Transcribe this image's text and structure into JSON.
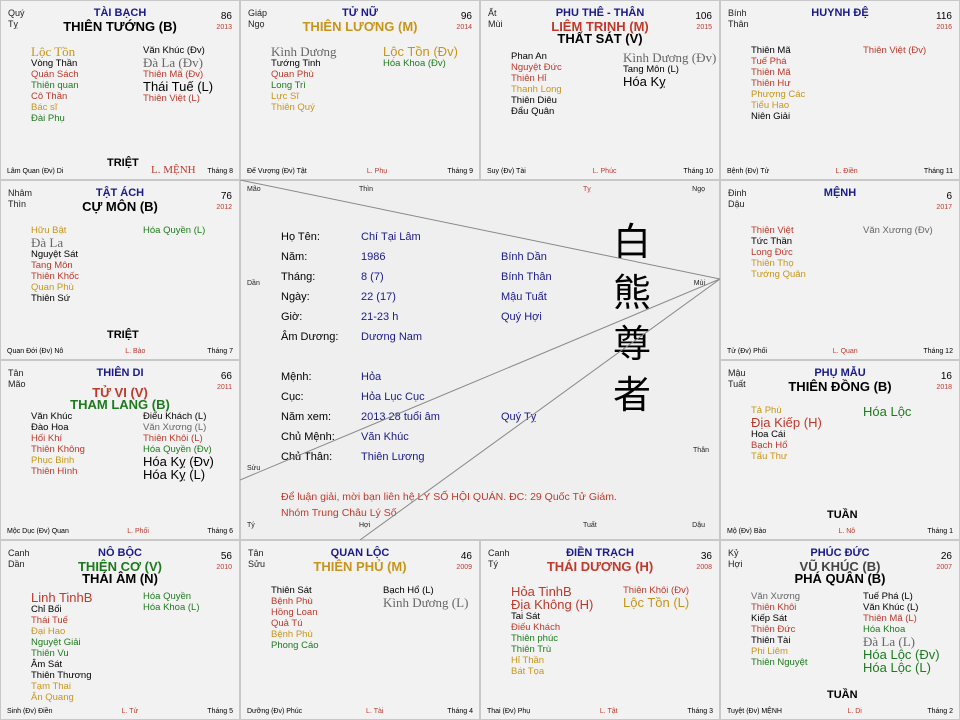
{
  "cells": {
    "taibach": {
      "can": [
        "Quý",
        "Tỵ"
      ],
      "palace": "TÀI BẠCH",
      "age": "86",
      "year": "2013",
      "main": [
        "THIÊN TƯỚNG (B)"
      ],
      "left": [
        [
          "Lộc Tồn",
          "cgold big serif"
        ],
        [
          "Vòng Thần",
          "cblk"
        ],
        [
          "Quán Sách",
          "cr"
        ],
        [
          "Thiên quan",
          "cg"
        ],
        [
          "Cô Thần",
          "cr"
        ],
        [
          "Bác sĩ",
          "cgold"
        ],
        [
          "Đài Phụ",
          "cg"
        ]
      ],
      "right": [
        [
          "Văn Khúc (Đv)",
          "cblk"
        ],
        [
          "Đà La (Đv)",
          "cgray big serif"
        ],
        [
          "Thiên Mã (Đv)",
          "cr"
        ],
        [
          "Thái Tuế (L)",
          "cblk big"
        ],
        [
          "Thiên Việt (L)",
          "cr"
        ]
      ],
      "mark": "TRIỆT",
      "mark2": "L. MỆNH",
      "foot": [
        "Lâm Quan (Đv) Di",
        "",
        "Tháng 8"
      ]
    },
    "tunu": {
      "can": [
        "Giáp",
        "Ngọ"
      ],
      "palace": "TỬ NỮ",
      "age": "96",
      "year": "2014",
      "main": [
        "THIÊN LƯƠNG (M)"
      ],
      "left": [
        [
          "Kình Dương",
          "cgray big serif"
        ],
        [
          "Tướng Tinh",
          "cblk"
        ],
        [
          "Quan Phù",
          "cr"
        ],
        [
          "Long Trì",
          "cg"
        ],
        [
          "Lực Sĩ",
          "cgold"
        ],
        [
          "Thiên Quý",
          "cgold"
        ]
      ],
      "right": [
        [
          "Lộc Tồn (Đv)",
          "cgold big"
        ],
        [
          "Hóa Khoa (Đv)",
          "cg"
        ]
      ],
      "foot": [
        "Đế Vượng (Đv) Tật",
        "L. Phụ",
        "Tháng 9"
      ]
    },
    "phuthe": {
      "can": [
        "Ất",
        "Mùi"
      ],
      "palace": "PHU THÊ - THÂN",
      "age": "106",
      "year": "2015",
      "main": [
        "LIÊM TRINH (M)",
        "THẤT SÁT (V)"
      ],
      "left": [
        [
          "Phan An",
          "cblk"
        ],
        [
          "Nguyệt Đức",
          "cr"
        ],
        [
          "Thiên Hỉ",
          "cr"
        ],
        [
          "Thanh Long",
          "cgold"
        ],
        [
          "Thiên Diêu",
          "cblk"
        ],
        [
          "Đẩu Quân",
          "cblk"
        ]
      ],
      "right": [
        [
          "Kình Dương (Đv)",
          "cgray big serif"
        ],
        [
          "Tang Môn (L)",
          "cblk"
        ],
        [
          "Hóa Kỵ",
          "cblk big"
        ]
      ],
      "foot": [
        "Suy (Đv) Tài",
        "L. Phúc",
        "Tháng 10"
      ]
    },
    "huynhde": {
      "can": [
        "Bính",
        "Thân"
      ],
      "palace": "HUYNH ĐỆ",
      "age": "116",
      "year": "2016",
      "main": [],
      "left": [
        [
          "Thiên Mã",
          "cblk"
        ],
        [
          "Tuế Phá",
          "cr"
        ],
        [
          "Thiên Mã",
          "cr"
        ],
        [
          "Thiên Hư",
          "cr"
        ],
        [
          "Phượng Các",
          "cgold"
        ],
        [
          "Tiểu Hao",
          "cgold"
        ],
        [
          "Niên Giải",
          "cblk"
        ]
      ],
      "right": [
        [
          "Thiên Việt (Đv)",
          "cr"
        ]
      ],
      "foot": [
        "Bệnh (Đv) Tử",
        "L. Điền",
        "Tháng 11"
      ]
    },
    "tatach": {
      "can": [
        "Nhâm",
        "Thìn"
      ],
      "palace": "TẬT ÁCH",
      "age": "76",
      "year": "2012",
      "main": [
        "CỰ MÔN (B)"
      ],
      "left": [
        [
          "Hữu Bật",
          "cgold"
        ],
        [
          "Đà La",
          "cgray big serif"
        ],
        [
          "Nguyệt Sát",
          "cblk"
        ],
        [
          "Tang Môn",
          "cr"
        ],
        [
          "Thiên Khốc",
          "cr"
        ],
        [
          "Quan Phù",
          "cgold"
        ],
        [
          "Thiên Sứ",
          "cblk"
        ]
      ],
      "right": [
        [
          "Hóa Quyền (L)",
          "cg"
        ]
      ],
      "mark": "TRIỆT",
      "foot": [
        "Quan Đới (Đv) Nô",
        "L. Bào",
        "Tháng 7"
      ]
    },
    "menh": {
      "can": [
        "Đinh",
        "Dậu"
      ],
      "palace": "MỆNH",
      "age": "6",
      "year": "2017",
      "main": [],
      "left": [
        [
          "Thiên Việt",
          "cr"
        ],
        [
          "Tức Thần",
          "cblk"
        ],
        [
          "Long Đức",
          "cr"
        ],
        [
          "Thiên Thọ",
          "cgold"
        ],
        [
          "Tướng Quân",
          "cgold"
        ]
      ],
      "right": [
        [
          "Văn Xương (Đv)",
          "cgray"
        ]
      ],
      "foot": [
        "Tử (Đv) Phối",
        "L. Quan",
        "Tháng 12"
      ]
    },
    "thiendi": {
      "can": [
        "Tân",
        "Mão"
      ],
      "palace": "THIÊN DI",
      "age": "66",
      "year": "2011",
      "main": [
        "TỬ VI (V)",
        "THAM LANG (B)"
      ],
      "left": [
        [
          "Văn Khúc",
          "cblk"
        ],
        [
          "Đào Hoa",
          "cblk"
        ],
        [
          "Hối Khí",
          "cr"
        ],
        [
          "Thiên Không",
          "cr"
        ],
        [
          "Phục Binh",
          "cgold"
        ],
        [
          "Thiên Hình",
          "cr"
        ]
      ],
      "right": [
        [
          "Điếu Khách (L)",
          "cblk"
        ],
        [
          "Văn Xương (L)",
          "cgray"
        ],
        [
          "Thiên Khôi (L)",
          "cr"
        ],
        [
          "Hóa Quyền (Đv)",
          "cg"
        ],
        [
          "Hóa Kỵ (Đv)",
          "cblk big"
        ],
        [
          "Hóa Kỵ (L)",
          "cblk big"
        ]
      ],
      "foot": [
        "Mộc Dục (Đv) Quan",
        "L. Phối",
        "Tháng 6"
      ]
    },
    "phumau": {
      "can": [
        "Mậu",
        "Tuất"
      ],
      "palace": "PHỤ MẪU",
      "age": "16",
      "year": "2018",
      "main": [
        "THIÊN ĐỒNG (B)"
      ],
      "left": [
        [
          "Tả Phù",
          "cgold"
        ],
        [
          "Địa Kiếp (H)",
          "cr big"
        ],
        [
          "Hoa Cái",
          "cblk"
        ],
        [
          "Bạch Hổ",
          "cr"
        ],
        [
          "Tấu Thư",
          "cgold"
        ]
      ],
      "right": [
        [
          "Hóa Lộc",
          "cg big"
        ]
      ],
      "mark": "TUẦN",
      "foot": [
        "Mộ (Đv) Bào",
        "L. Nô",
        "Tháng 1"
      ]
    },
    "nobọc": {
      "can": [
        "Canh",
        "Dần"
      ],
      "palace": "NÔ BỘC",
      "age": "56",
      "year": "2010",
      "main": [
        "THIÊN CƠ (V)",
        "THÁI ÂM (N)"
      ],
      "left": [
        [
          "Linh TinhB",
          "cr big"
        ],
        [
          "Chỉ Bối",
          "cblk"
        ],
        [
          "Thái Tuế",
          "cr"
        ],
        [
          "Đại Hao",
          "cgold"
        ],
        [
          "Nguyệt Giải",
          "cg"
        ],
        [
          "Thiên Vu",
          "cg"
        ],
        [
          "Âm Sát",
          "cblk"
        ],
        [
          "Thiên Thương",
          "cblk"
        ],
        [
          "Tạm Thai",
          "cgold"
        ],
        [
          "Ân Quang",
          "cgold"
        ]
      ],
      "right": [
        [
          "Hóa Quyền",
          "cg"
        ],
        [
          "Hóa Khoa (L)",
          "cg"
        ]
      ],
      "foot": [
        "Sinh (Đv) Điền",
        "L. Tử",
        "Tháng 5"
      ]
    },
    "quanloc": {
      "can": [
        "Tân",
        "Sửu"
      ],
      "palace": "QUAN LỘC",
      "age": "46",
      "year": "2009",
      "main": [
        "THIÊN PHỦ (M)"
      ],
      "left": [
        [
          "Thiên Sát",
          "cblk"
        ],
        [
          "Bệnh Phù",
          "cr"
        ],
        [
          "Hồng Loan",
          "cr"
        ],
        [
          "Quả Tú",
          "cr"
        ],
        [
          "Bệnh Phù",
          "cgold"
        ],
        [
          "Phong Cáo",
          "cg"
        ]
      ],
      "right": [
        [
          "Bạch Hổ (L)",
          "cblk"
        ],
        [
          "Kình Dương (L)",
          "cgray big serif"
        ]
      ],
      "foot": [
        "Dưỡng (Đv) Phúc",
        "L. Tài",
        "Tháng 4"
      ]
    },
    "dientrach": {
      "can": [
        "Canh",
        "Tý"
      ],
      "palace": "ĐIỀN TRẠCH",
      "age": "36",
      "year": "2008",
      "main": [
        "THÁI DƯƠNG (H)"
      ],
      "left": [
        [
          "Hỏa TinhB",
          "cr big"
        ],
        [
          "Địa Không (H)",
          "cr big"
        ],
        [
          "Tai Sát",
          "cblk"
        ],
        [
          "Điếu Khách",
          "cr"
        ],
        [
          "Thiên phúc",
          "cg"
        ],
        [
          "Thiên Trù",
          "cg"
        ],
        [
          "Hỉ Thần",
          "cgold"
        ],
        [
          "Bát Tọa",
          "cgold"
        ]
      ],
      "right": [
        [
          "Thiên Khôi (Đv)",
          "cr"
        ],
        [
          "Lộc Tồn (L)",
          "cgold big"
        ]
      ],
      "foot": [
        "Thai (Đv) Phụ",
        "L. Tật",
        "Tháng 3"
      ]
    },
    "phucduc": {
      "can": [
        "Kỷ",
        "Hợi"
      ],
      "palace": "PHÚC ĐỨC",
      "age": "26",
      "year": "2007",
      "main": [
        "VŨ KHÚC (B)",
        "PHÁ QUÂN (B)"
      ],
      "left": [
        [
          "Văn Xương",
          "cgray"
        ],
        [
          "Thiên Khôi",
          "cr"
        ],
        [
          "Kiếp Sát",
          "cblk"
        ],
        [
          "Thiên Đức",
          "cr"
        ],
        [
          "Thiên Tài",
          "cblk"
        ],
        [
          "Phi Liêm",
          "cgold"
        ],
        [
          "Thiên Nguyệt",
          "cg"
        ]
      ],
      "right": [
        [
          "Tuế Phá (L)",
          "cblk"
        ],
        [
          "Văn Khúc (L)",
          "cblk"
        ],
        [
          "Thiên Mã (L)",
          "cr"
        ],
        [
          "Hóa Khoa",
          "cg"
        ],
        [
          "Đà La (L)",
          "cgray big serif"
        ],
        [
          "Hóa Lộc (Đv)",
          "cg big"
        ],
        [
          "Hóa Lộc (L)",
          "cg big"
        ]
      ],
      "mark": "TUẦN",
      "foot": [
        "Tuyệt (Đv) MỆNH",
        "L. Di",
        "Tháng 2"
      ]
    }
  },
  "center": {
    "branches": {
      "tl": "Mão",
      "tr": "Ngọ",
      "mt": "Thìn",
      "mtr": "Tỵ",
      "l1": "Dần",
      "r1": "Mùi",
      "r2": "Thân",
      "l2": "Sửu",
      "bl": "Tý",
      "bm": "Hợi",
      "bmr": "Tuất",
      "br": "Dậu"
    },
    "rows": [
      {
        "label": "Họ Tên:",
        "v1": "Chí Tại Lâm",
        "v2": ""
      },
      {
        "label": "Năm:",
        "v1": "1986",
        "v2": "Bính Dần"
      },
      {
        "label": "Tháng:",
        "v1": "8 (7)",
        "v2": "Bính Thân"
      },
      {
        "label": "Ngày:",
        "v1": "22 (17)",
        "v2": "Mậu Tuất"
      },
      {
        "label": "Giờ:",
        "v1": "21-23 h",
        "v2": "Quý Hợi"
      },
      {
        "label": "Âm Dương:",
        "v1": "Dương Nam",
        "v2": ""
      },
      {
        "label": "Mệnh:",
        "v1": "Hỏa",
        "v2": ""
      },
      {
        "label": "Cục:",
        "v1": "Hỏa Lục Cục",
        "v2": ""
      },
      {
        "label": "Năm xem:",
        "v1": "2013   28 tuổi âm",
        "v2": "Quý Tỵ"
      },
      {
        "label": "Chủ Mệnh:",
        "v1": "Văn Khúc",
        "v2": ""
      },
      {
        "label": "Chủ Thân:",
        "v1": "Thiên Lương",
        "v2": ""
      }
    ],
    "kanji": [
      "白",
      "熊",
      "尊",
      "者"
    ],
    "note1": "Để luận giải, mời bạn liên hệ LÝ SỐ HỘI QUÁN. ĐC: 29 Quốc Tử Giám.",
    "note2": "Nhóm Trung Châu Lý Số"
  }
}
